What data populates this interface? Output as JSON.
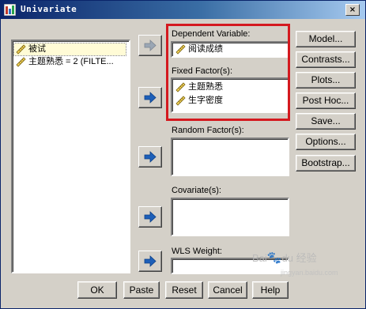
{
  "window": {
    "title": "Univariate",
    "close_glyph": "×"
  },
  "variable_list": [
    {
      "label": "被试",
      "icon": "scale-ruler-icon",
      "selected": true
    },
    {
      "label": "主题熟悉 = 2 (FILTE...",
      "icon": "scale-ruler-icon",
      "selected": false
    }
  ],
  "dependent": {
    "label": "Dependent Variable:",
    "value": "阅读成绩",
    "icon": "scale-ruler-icon"
  },
  "fixed": {
    "label": "Fixed Factor(s):",
    "items": [
      "主题熟悉",
      "生字密度"
    ]
  },
  "random": {
    "label": "Random Factor(s):"
  },
  "covariate": {
    "label": "Covariate(s):"
  },
  "wls": {
    "label": "WLS Weight:"
  },
  "side_buttons": {
    "model": "Model...",
    "contrasts": "Contrasts...",
    "plots": "Plots...",
    "posthoc": "Post Hoc...",
    "save": "Save...",
    "options": "Options...",
    "bootstrap": "Bootstrap..."
  },
  "bottom_buttons": {
    "ok": "OK",
    "paste": "Paste",
    "reset": "Reset",
    "cancel": "Cancel",
    "help": "Help"
  },
  "watermark": {
    "text": "Bai",
    "paw": "du",
    "suffix": "经验",
    "url": "jingyan.baidu.com"
  },
  "colors": {
    "highlight_box": "#d4191f",
    "selection": "#fffbd6",
    "titlebar": "#0a246a",
    "arrow": "#1d5fb8"
  }
}
